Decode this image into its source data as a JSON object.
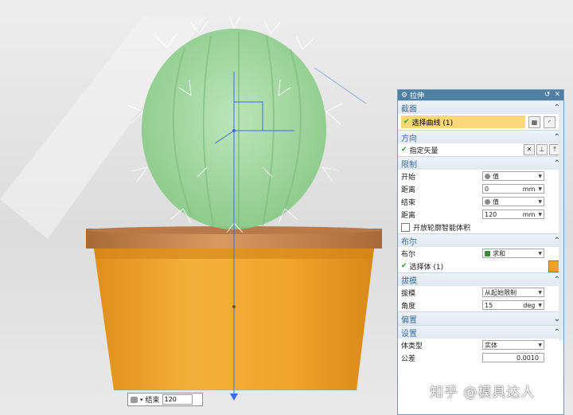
{
  "scene": {
    "colors": {
      "cactus": "#9ed39c",
      "pot": "#f0a52a",
      "rim": "#c7834a",
      "background": "#e4e4e4",
      "axis": "#3c6cf0"
    }
  },
  "float_input": {
    "label": "结束",
    "value": "120"
  },
  "dialog": {
    "title": "拉伸",
    "title_icons": [
      "gear-icon",
      "reset-icon",
      "close-icon"
    ],
    "sections": {
      "section": {
        "title": "截面",
        "select_curve": "选择曲线 (1)"
      },
      "direction": {
        "title": "方向",
        "specify_vector": "指定矢量"
      },
      "limits": {
        "title": "限制",
        "start_label": "开始",
        "start_value": "值",
        "distance1_label": "距离",
        "distance1_value": "0",
        "distance1_unit": "mm",
        "end_label": "结束",
        "end_value": "值",
        "distance2_label": "距离",
        "distance2_value": "120",
        "distance2_unit": "mm",
        "open_profile_label": "开放轮廓智能体积"
      },
      "boolean": {
        "title": "布尔",
        "bool_label": "布尔",
        "bool_value": "求和",
        "select_body": "选择体 (1)"
      },
      "draft": {
        "title": "拔模",
        "draft_label": "拔模",
        "draft_value": "从起始限制",
        "angle_label": "角度",
        "angle_value": "15",
        "angle_unit": "deg"
      },
      "offset": {
        "title": "偏置"
      },
      "settings": {
        "title": "设置",
        "body_type_label": "体类型",
        "body_type_value": "实体",
        "tolerance_label": "公差",
        "tolerance_value": "0.0010"
      }
    }
  },
  "watermark": "知乎 @模具达人"
}
